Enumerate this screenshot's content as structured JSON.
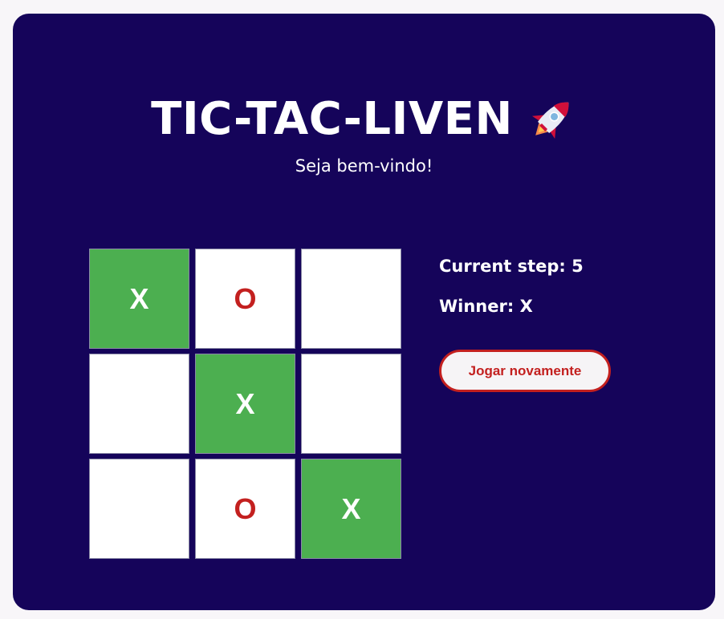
{
  "header": {
    "title": "TIC-TAC-LIVEN",
    "title_icon": "rocket-icon",
    "subtitle": "Seja bem-vindo!"
  },
  "board": {
    "cells": [
      "X",
      "O",
      "",
      "",
      "X",
      "",
      "",
      "O",
      "X"
    ],
    "winning_cells": [
      0,
      4,
      8
    ]
  },
  "status": {
    "current_step": "Current step: 5",
    "winner": "Winner: X"
  },
  "actions": {
    "replay_label": "Jogar novamente"
  },
  "colors": {
    "background": "#15045a",
    "win_cell": "#4caf50",
    "o_mark": "#c3201f",
    "button_accent": "#c3201f"
  }
}
